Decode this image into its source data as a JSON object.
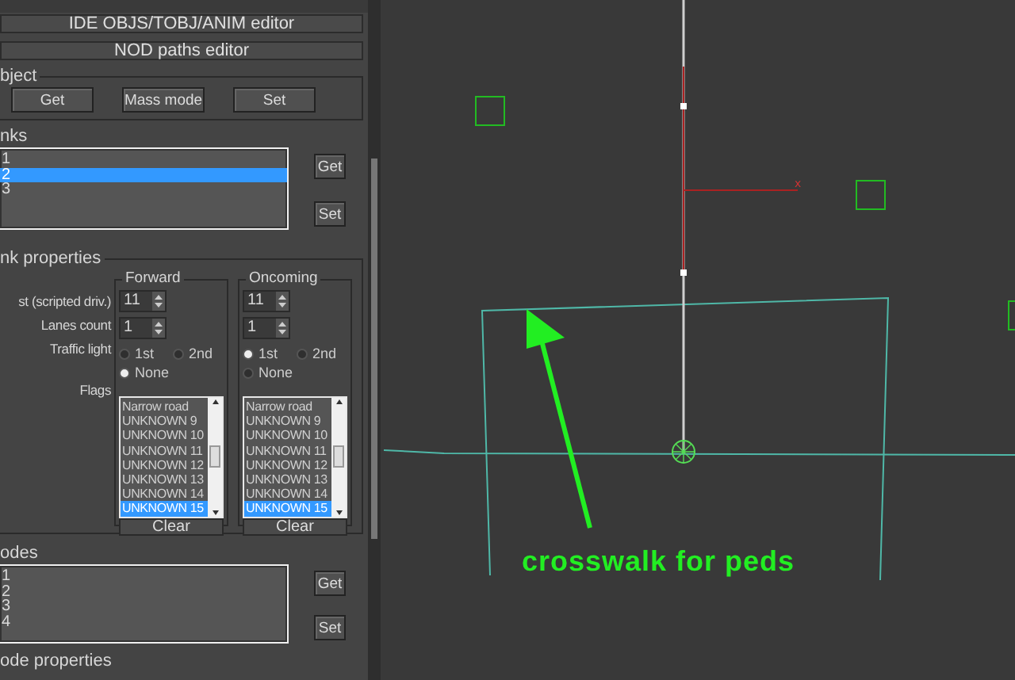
{
  "editors": [
    {
      "label": "IDE OBJS/TOBJ/ANIM editor"
    },
    {
      "label": "NOD paths editor"
    }
  ],
  "object_group": {
    "title": "bject",
    "buttons": [
      "Get",
      "Mass mode",
      "Set"
    ]
  },
  "links": {
    "title": "nks",
    "items": [
      {
        "label": "1",
        "selected": false
      },
      {
        "label": "2",
        "selected": true
      },
      {
        "label": "3",
        "selected": false
      }
    ],
    "buttons": [
      "Get",
      "Set"
    ]
  },
  "link_properties": {
    "title": "nk properties",
    "row_labels": [
      "st (scripted driv.)",
      "Lanes count",
      "Traffic light",
      "Flags"
    ],
    "directions": [
      {
        "title": "Forward",
        "speed": "11",
        "lanes": "1",
        "traffic_light": [
          {
            "label": "1st",
            "selected": false
          },
          {
            "label": "2nd",
            "selected": false
          },
          {
            "label": "None",
            "selected": true
          }
        ],
        "flags": [
          {
            "label": "Narrow road",
            "selected": false
          },
          {
            "label": "UNKNOWN 9",
            "selected": false
          },
          {
            "label": "UNKNOWN 10",
            "selected": false
          },
          {
            "label": "UNKNOWN 11",
            "selected": false
          },
          {
            "label": "UNKNOWN 12",
            "selected": false
          },
          {
            "label": "UNKNOWN 13",
            "selected": false
          },
          {
            "label": "UNKNOWN 14",
            "selected": false
          },
          {
            "label": "UNKNOWN 15",
            "selected": true
          }
        ],
        "clear": "Clear"
      },
      {
        "title": "Oncoming",
        "speed": "11",
        "lanes": "1",
        "traffic_light": [
          {
            "label": "1st",
            "selected": true
          },
          {
            "label": "2nd",
            "selected": false
          },
          {
            "label": "None",
            "selected": false
          }
        ],
        "flags": [
          {
            "label": "Narrow road",
            "selected": false
          },
          {
            "label": "UNKNOWN 9",
            "selected": false
          },
          {
            "label": "UNKNOWN 10",
            "selected": false
          },
          {
            "label": "UNKNOWN 11",
            "selected": false
          },
          {
            "label": "UNKNOWN 12",
            "selected": false
          },
          {
            "label": "UNKNOWN 13",
            "selected": false
          },
          {
            "label": "UNKNOWN 14",
            "selected": false
          },
          {
            "label": "UNKNOWN 15",
            "selected": true
          }
        ],
        "clear": "Clear"
      }
    ]
  },
  "nodes": {
    "title": "odes",
    "items": [
      {
        "label": "1",
        "selected": false
      },
      {
        "label": "2",
        "selected": false
      },
      {
        "label": "3",
        "selected": false
      },
      {
        "label": "4",
        "selected": false
      }
    ],
    "buttons": [
      "Get",
      "Set"
    ]
  },
  "node_properties": {
    "title": "ode properties"
  },
  "viewport": {
    "axis_label": "x",
    "annotation": "crosswalk for peds"
  }
}
